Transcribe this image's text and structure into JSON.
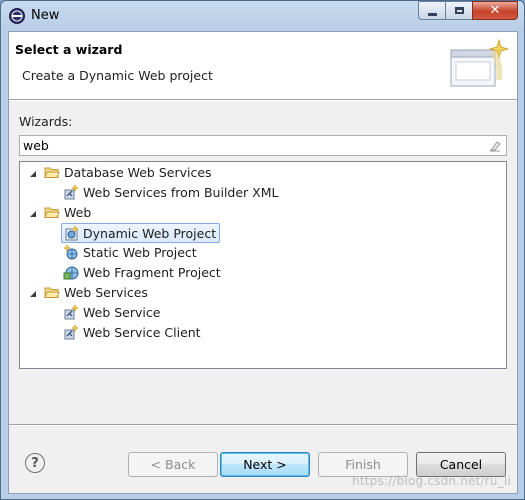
{
  "window": {
    "title": "New"
  },
  "header": {
    "title": "Select a wizard",
    "description": "Create a Dynamic Web project"
  },
  "filter": {
    "label": "Wizards:",
    "value": "web"
  },
  "tree": {
    "items": [
      {
        "label": "Database Web Services",
        "icon": "folder-open-icon"
      },
      {
        "label": "Web Services from Builder XML",
        "icon": "web-service-wizard-icon"
      },
      {
        "label": "Web",
        "icon": "folder-open-icon"
      },
      {
        "label": "Dynamic Web Project",
        "icon": "dynamic-web-project-icon",
        "selected": true
      },
      {
        "label": "Static Web Project",
        "icon": "static-web-project-icon"
      },
      {
        "label": "Web Fragment Project",
        "icon": "web-fragment-project-icon"
      },
      {
        "label": "Web Services",
        "icon": "folder-open-icon"
      },
      {
        "label": "Web Service",
        "icon": "web-service-wizard-icon"
      },
      {
        "label": "Web Service Client",
        "icon": "web-service-wizard-icon"
      }
    ]
  },
  "buttons": {
    "back": "< Back",
    "next": "Next >",
    "finish": "Finish",
    "cancel": "Cancel",
    "help": "?"
  },
  "watermark": "https://blog.csdn.net/ru_li"
}
